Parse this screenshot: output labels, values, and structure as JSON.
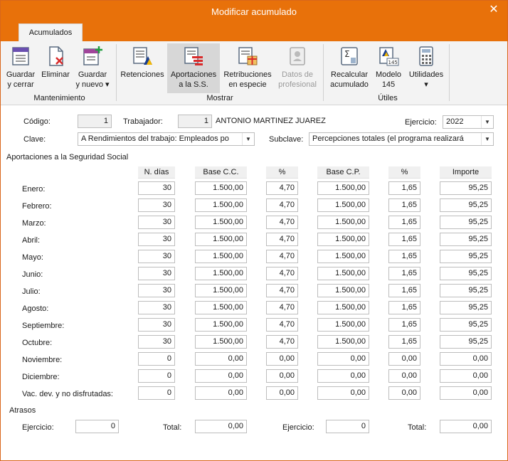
{
  "window": {
    "title": "Modificar acumulado"
  },
  "ribbon": {
    "tab": "Acumulados",
    "groups": {
      "mantenimiento": "Mantenimiento",
      "mostrar": "Mostrar",
      "utiles": "Útiles"
    },
    "buttons": {
      "guardar_cerrar": [
        "Guardar",
        "y cerrar"
      ],
      "eliminar": [
        "Eliminar"
      ],
      "guardar_nuevo": [
        "Guardar",
        "y nuevo ▾"
      ],
      "retenciones": [
        "Retenciones"
      ],
      "aportaciones": [
        "Aportaciones",
        "a la S.S."
      ],
      "retribuciones": [
        "Retribuciones",
        "en especie"
      ],
      "datos_profesional": [
        "Datos de",
        "profesional"
      ],
      "recalcular": [
        "Recalcular",
        "acumulado"
      ],
      "modelo145": [
        "Modelo",
        "145"
      ],
      "utilidades": [
        "Utilidades",
        "▾"
      ]
    }
  },
  "form": {
    "codigo_label": "Código:",
    "codigo": "1",
    "trabajador_label": "Trabajador:",
    "trabajador_code": "1",
    "trabajador_name": "ANTONIO MARTINEZ JUAREZ",
    "ejercicio_label": "Ejercicio:",
    "ejercicio": "2022",
    "clave_label": "Clave:",
    "clave_value": "A   Rendimientos del trabajo: Empleados po",
    "subclave_label": "Subclave:",
    "subclave_value": "Percepciones totales (el programa realizará"
  },
  "section_title": "Aportaciones a la Seguridad Social",
  "columns": [
    "N. días",
    "Base C.C.",
    "%",
    "Base C.P.",
    "%",
    "Importe"
  ],
  "rows": [
    {
      "label": "Enero:",
      "cells": [
        "30",
        "1.500,00",
        "4,70",
        "1.500,00",
        "1,65",
        "95,25"
      ]
    },
    {
      "label": "Febrero:",
      "cells": [
        "30",
        "1.500,00",
        "4,70",
        "1.500,00",
        "1,65",
        "95,25"
      ]
    },
    {
      "label": "Marzo:",
      "cells": [
        "30",
        "1.500,00",
        "4,70",
        "1.500,00",
        "1,65",
        "95,25"
      ]
    },
    {
      "label": "Abril:",
      "cells": [
        "30",
        "1.500,00",
        "4,70",
        "1.500,00",
        "1,65",
        "95,25"
      ]
    },
    {
      "label": "Mayo:",
      "cells": [
        "30",
        "1.500,00",
        "4,70",
        "1.500,00",
        "1,65",
        "95,25"
      ]
    },
    {
      "label": "Junio:",
      "cells": [
        "30",
        "1.500,00",
        "4,70",
        "1.500,00",
        "1,65",
        "95,25"
      ]
    },
    {
      "label": "Julio:",
      "cells": [
        "30",
        "1.500,00",
        "4,70",
        "1.500,00",
        "1,65",
        "95,25"
      ]
    },
    {
      "label": "Agosto:",
      "cells": [
        "30",
        "1.500,00",
        "4,70",
        "1.500,00",
        "1,65",
        "95,25"
      ]
    },
    {
      "label": "Septiembre:",
      "cells": [
        "30",
        "1.500,00",
        "4,70",
        "1.500,00",
        "1,65",
        "95,25"
      ]
    },
    {
      "label": "Octubre:",
      "cells": [
        "30",
        "1.500,00",
        "4,70",
        "1.500,00",
        "1,65",
        "95,25"
      ]
    },
    {
      "label": "Noviembre:",
      "cells": [
        "0",
        "0,00",
        "0,00",
        "0,00",
        "0,00",
        "0,00"
      ]
    },
    {
      "label": "Diciembre:",
      "cells": [
        "0",
        "0,00",
        "0,00",
        "0,00",
        "0,00",
        "0,00"
      ]
    },
    {
      "label": "Vac. dev. y no disfrutadas:",
      "cells": [
        "0",
        "0,00",
        "0,00",
        "0,00",
        "0,00",
        "0,00"
      ]
    }
  ],
  "atrasos": {
    "title": "Atrasos",
    "ejercicio1_label": "Ejercicio:",
    "ejercicio1": "0",
    "total1_label": "Total:",
    "total1": "0,00",
    "ejercicio2_label": "Ejercicio:",
    "ejercicio2": "0",
    "total2_label": "Total:",
    "total2": "0,00"
  },
  "colors": {
    "accent": "#e8710a",
    "ribbon_bg": "#f3f3f3",
    "active_button": "#d7d7d7"
  }
}
